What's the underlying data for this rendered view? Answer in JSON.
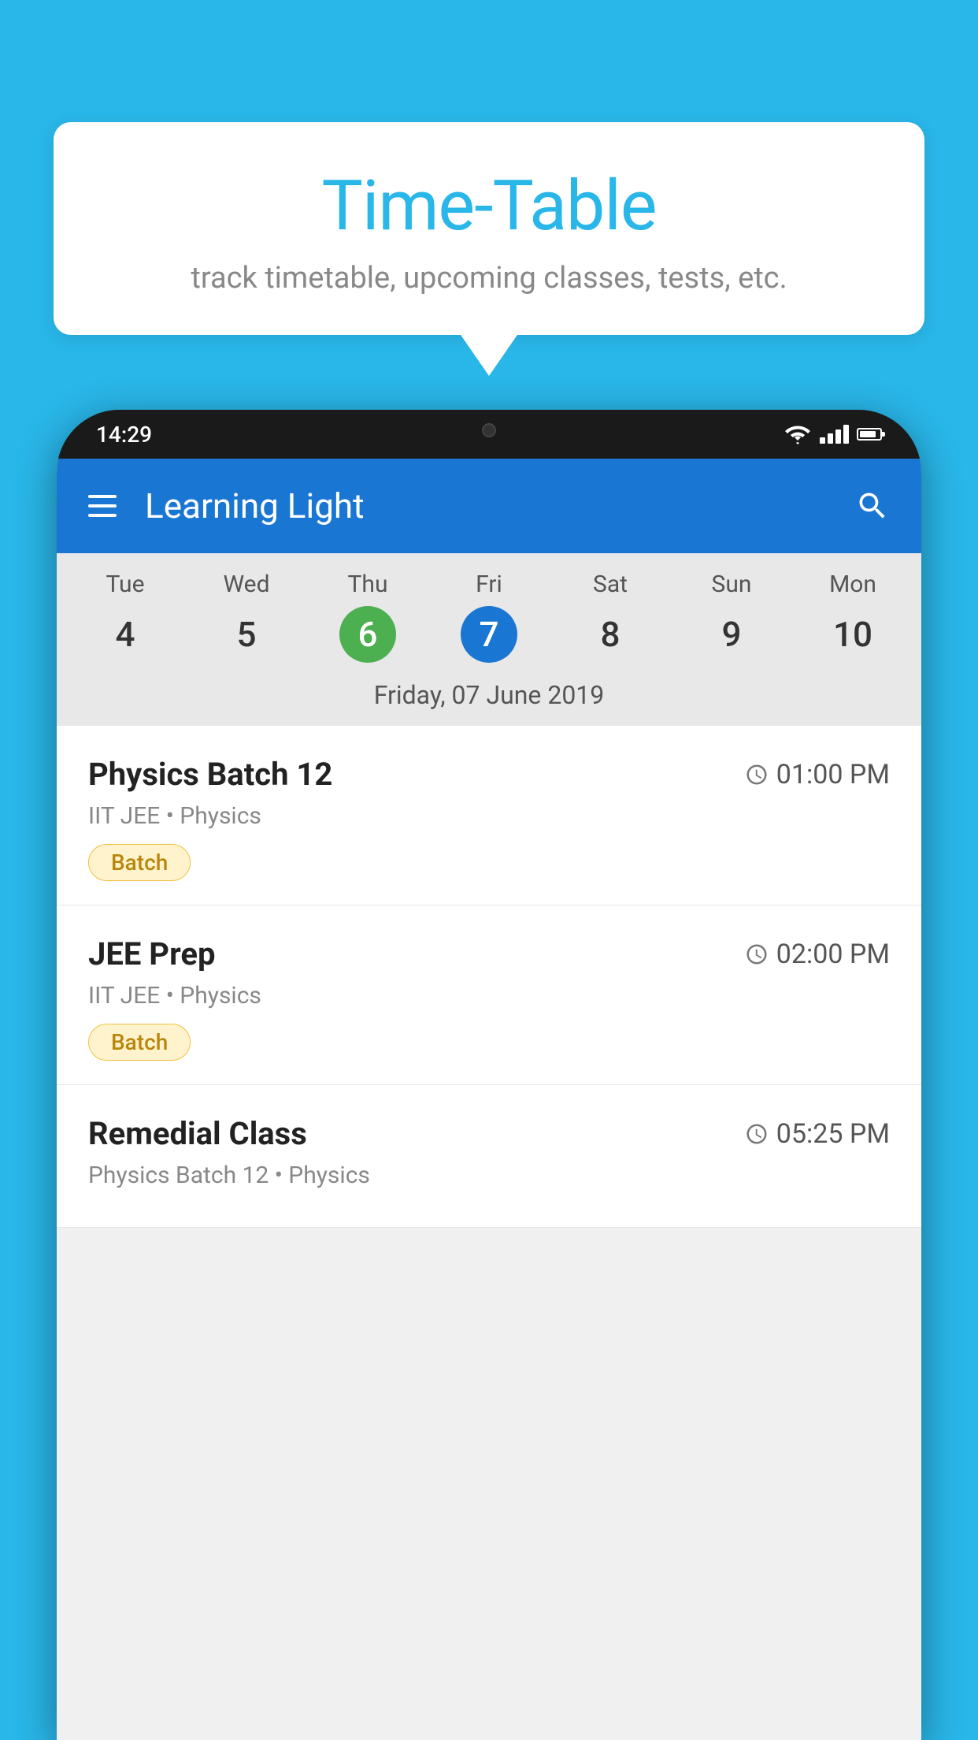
{
  "background_color": "#29b6e8",
  "bubble": {
    "title": "Time-Table",
    "subtitle": "track timetable, upcoming classes, tests, etc."
  },
  "status_bar": {
    "time": "14:29"
  },
  "app_header": {
    "title": "Learning Light"
  },
  "calendar": {
    "days": [
      {
        "name": "Tue",
        "number": "4",
        "state": "normal"
      },
      {
        "name": "Wed",
        "number": "5",
        "state": "normal"
      },
      {
        "name": "Thu",
        "number": "6",
        "state": "today"
      },
      {
        "name": "Fri",
        "number": "7",
        "state": "selected"
      },
      {
        "name": "Sat",
        "number": "8",
        "state": "normal"
      },
      {
        "name": "Sun",
        "number": "9",
        "state": "normal"
      },
      {
        "name": "Mon",
        "number": "10",
        "state": "normal"
      }
    ],
    "selected_date_label": "Friday, 07 June 2019"
  },
  "schedule": {
    "items": [
      {
        "title": "Physics Batch 12",
        "time": "01:00 PM",
        "subtitle": "IIT JEE • Physics",
        "badge": "Batch"
      },
      {
        "title": "JEE Prep",
        "time": "02:00 PM",
        "subtitle": "IIT JEE • Physics",
        "badge": "Batch"
      },
      {
        "title": "Remedial Class",
        "time": "05:25 PM",
        "subtitle": "Physics Batch 12 • Physics",
        "badge": null
      }
    ]
  }
}
